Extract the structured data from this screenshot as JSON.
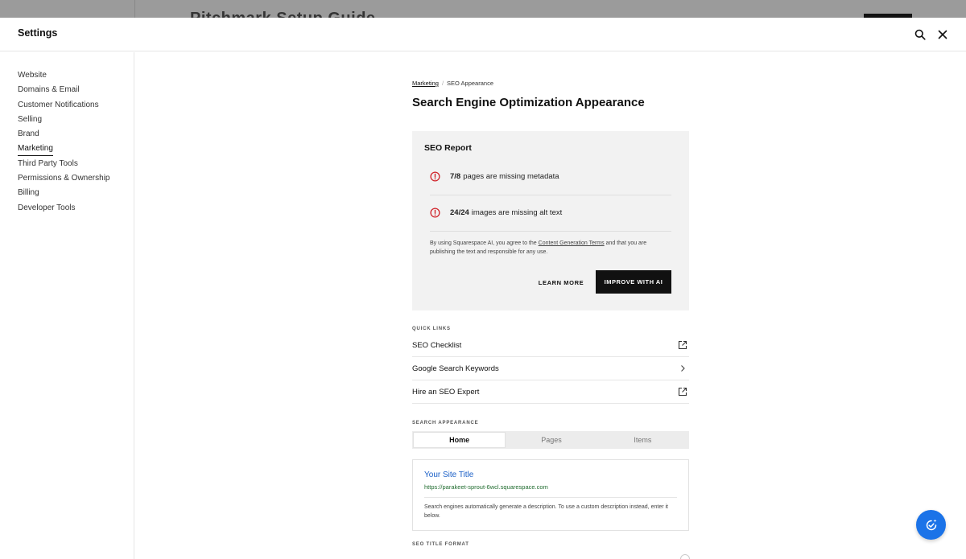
{
  "background": {
    "title": "Pitchmark Setup Guide"
  },
  "header": {
    "title": "Settings"
  },
  "sidebar": {
    "items": [
      {
        "label": "Website"
      },
      {
        "label": "Domains & Email"
      },
      {
        "label": "Customer Notifications"
      },
      {
        "label": "Selling"
      },
      {
        "label": "Brand"
      },
      {
        "label": "Marketing"
      },
      {
        "label": "Third Party Tools"
      },
      {
        "label": "Permissions & Ownership"
      },
      {
        "label": "Billing"
      },
      {
        "label": "Developer Tools"
      }
    ],
    "active": "Marketing"
  },
  "breadcrumb": {
    "parent": "Marketing",
    "current": "SEO Appearance"
  },
  "page_title": "Search Engine Optimization Appearance",
  "seo_report": {
    "title": "SEO Report",
    "issues": [
      {
        "count": "7/8",
        "text": "pages are missing metadata"
      },
      {
        "count": "24/24",
        "text": "images are missing alt text"
      }
    ],
    "disclaimer_pre": "By using Squarespace AI, you agree to the ",
    "disclaimer_link": "Content Generation Terms",
    "disclaimer_post": " and that you are publishing the text and responsible for any use.",
    "learn_more_label": "LEARN MORE",
    "improve_label": "IMPROVE WITH AI"
  },
  "quick_links": {
    "label": "QUICK LINKS",
    "items": [
      {
        "label": "SEO Checklist",
        "icon": "external-link-icon"
      },
      {
        "label": "Google Search Keywords",
        "icon": "chevron-right-icon"
      },
      {
        "label": "Hire an SEO Expert",
        "icon": "external-link-icon"
      }
    ]
  },
  "search_appearance": {
    "label": "SEARCH APPEARANCE",
    "tabs": [
      {
        "label": "Home"
      },
      {
        "label": "Pages"
      },
      {
        "label": "Items"
      }
    ],
    "active_tab": "Home",
    "preview": {
      "site_title": "Your Site Title",
      "url": "https://parakeet-sprout-6wcl.squarespace.com",
      "description": "Search engines automatically generate a description. To use a custom description instead, enter it below."
    }
  },
  "seo_title_format": {
    "label": "SEO TITLE FORMAT"
  },
  "colors": {
    "accent_blue": "#1b73e8",
    "warning_red": "#d0242b",
    "link_blue": "#1a5fc7",
    "url_green": "#1f6b2e"
  }
}
